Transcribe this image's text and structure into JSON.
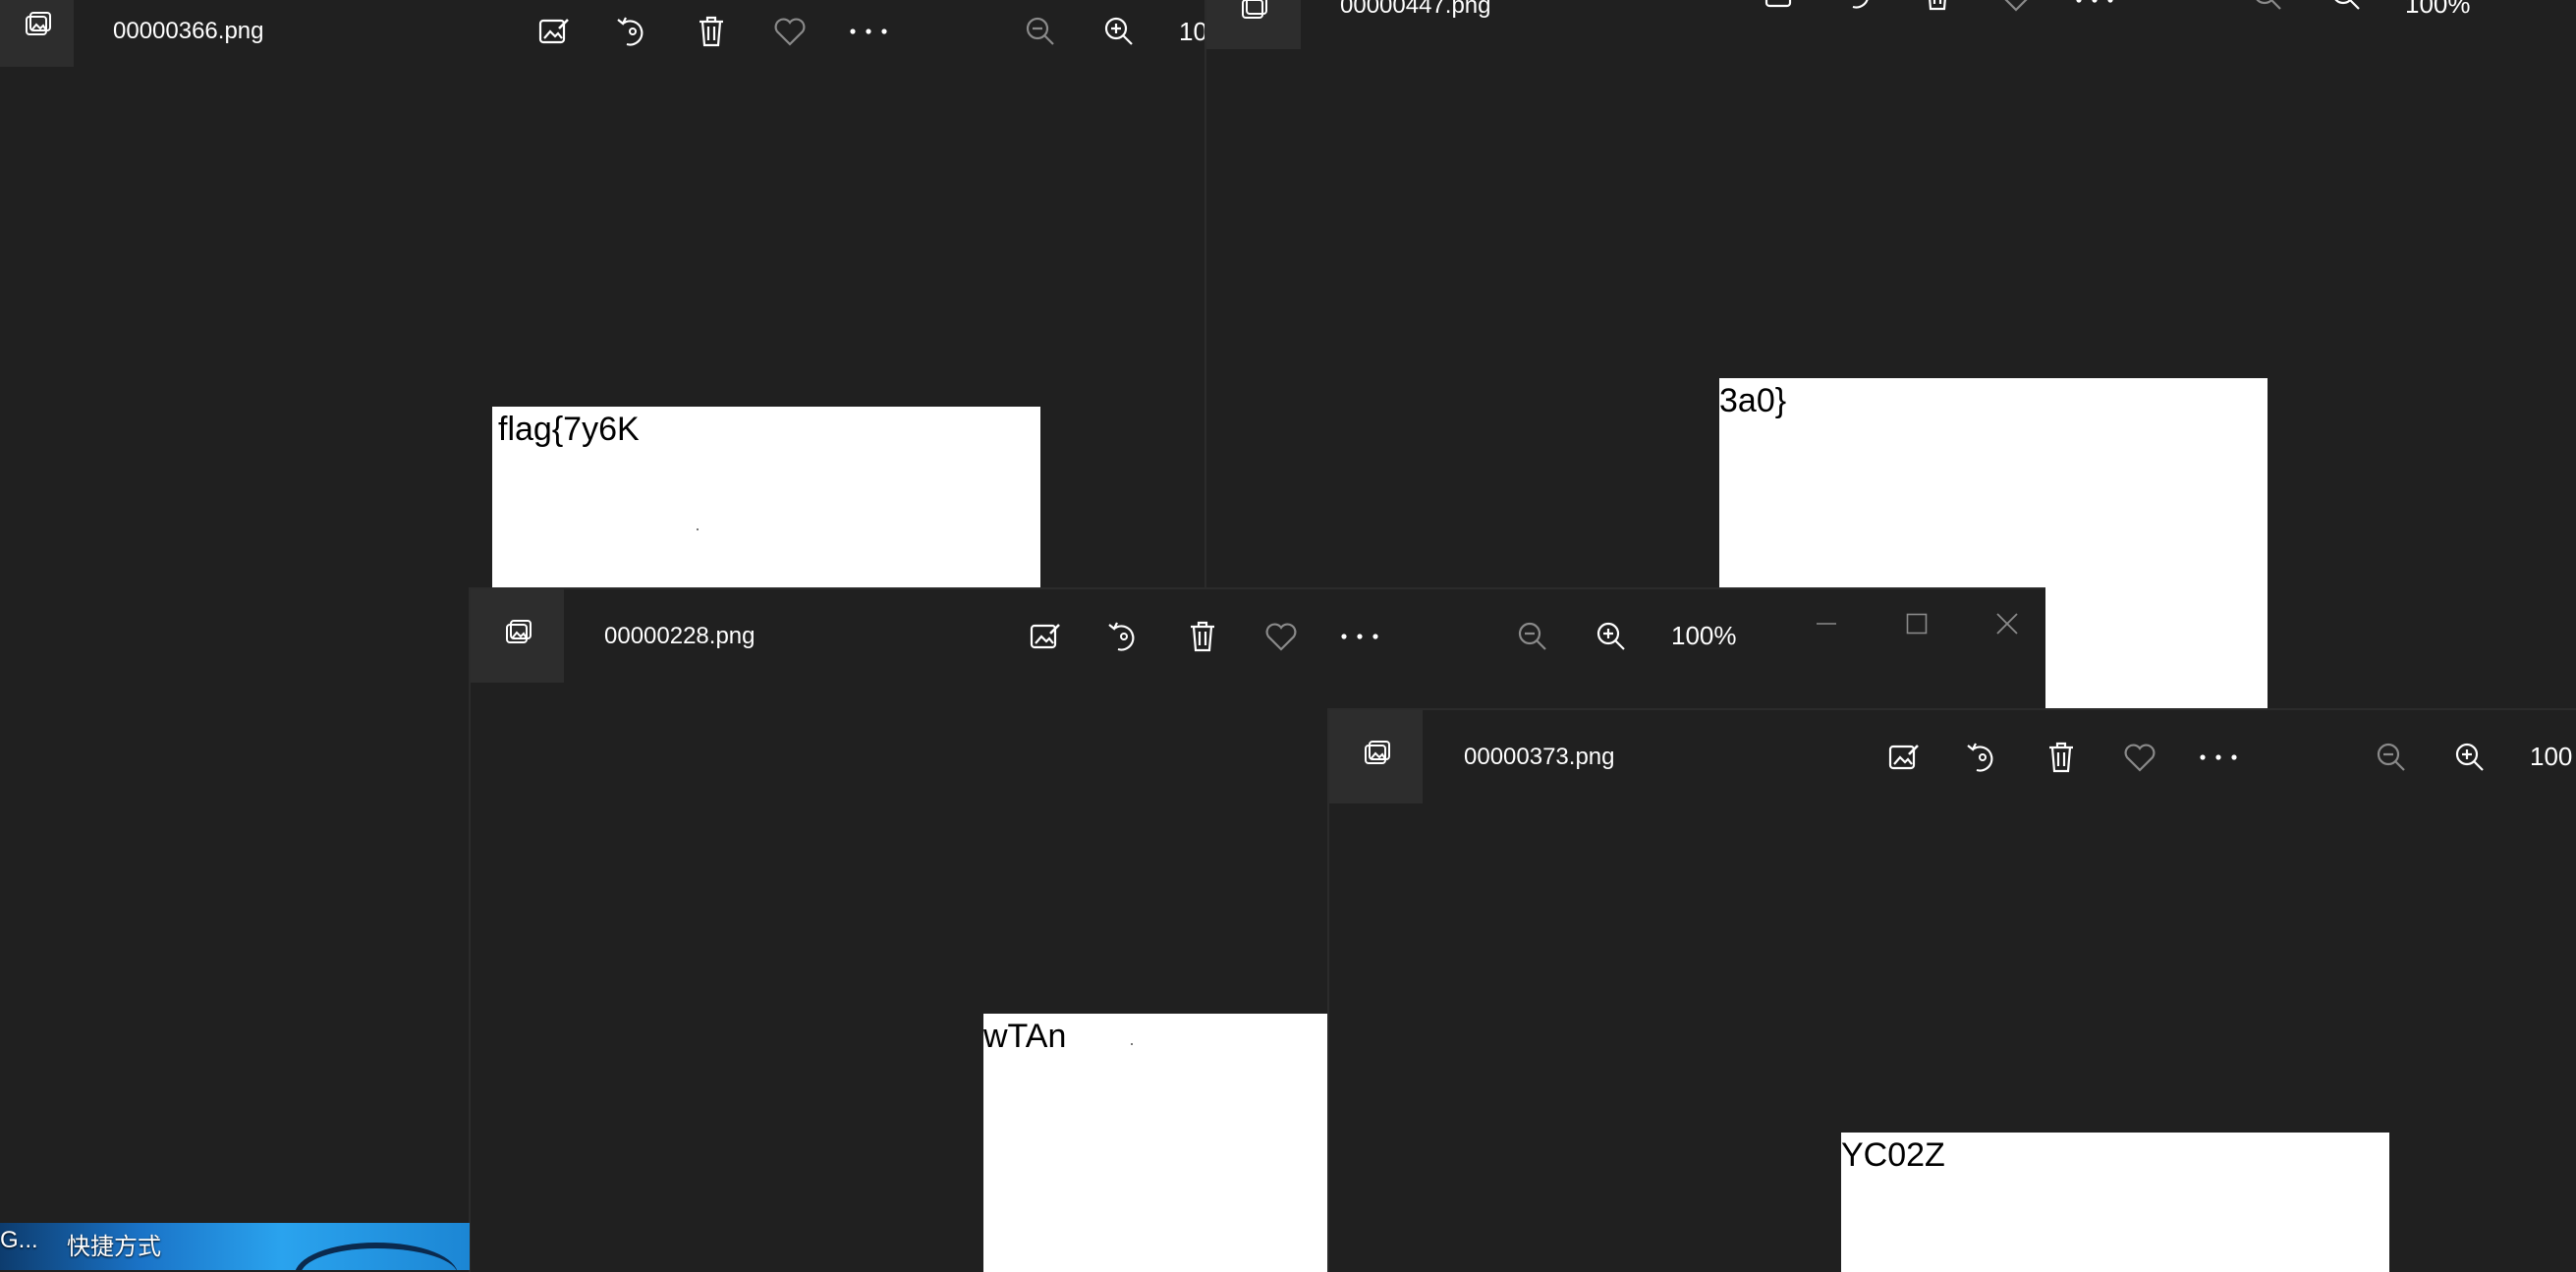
{
  "windows": {
    "w366": {
      "file_name": "00000366.png",
      "zoom": "10",
      "image_text": "flag{7y6K"
    },
    "w447": {
      "file_name": "00000447.png",
      "zoom": "100%",
      "image_text": "3a0}"
    },
    "w228": {
      "file_name": "00000228.png",
      "zoom": "100%",
      "image_text": "wTAn"
    },
    "w373": {
      "file_name": "00000373.png",
      "zoom": "100",
      "image_text": "YC02Z"
    }
  },
  "toolbar_icons": [
    "edit-image-icon",
    "rotate-icon",
    "delete-icon",
    "favorite-icon",
    "more-icon",
    "zoom-out-icon",
    "zoom-in-icon"
  ],
  "window_controls": [
    "minimize-icon",
    "maximize-icon",
    "close-icon"
  ],
  "desktop": {
    "shortcut_prefix": "G...",
    "shortcut_label": "快捷方式"
  },
  "colors": {
    "background": "#202020",
    "titlebar_icon_box": "#2d2d2d",
    "foreground": "#ffffff",
    "disabled": "#8a8a8a"
  }
}
